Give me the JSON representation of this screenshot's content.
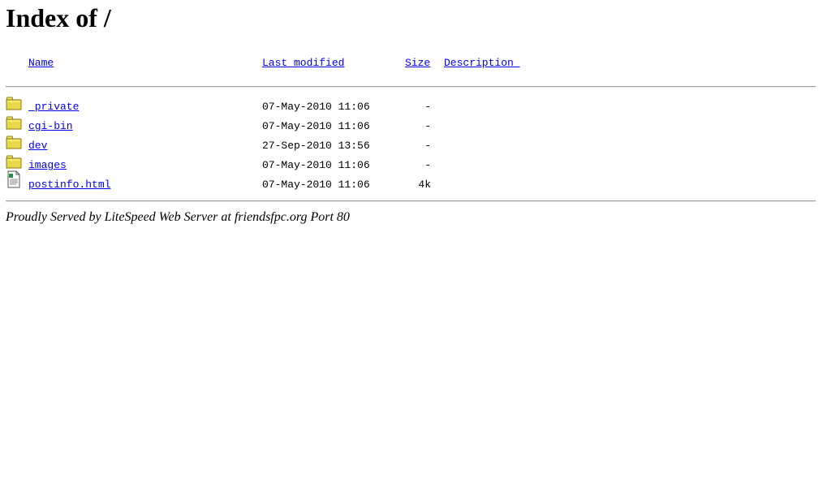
{
  "page": {
    "title": "Index of /"
  },
  "columns": {
    "name": "Name",
    "last_modified": "Last modified",
    "size": "Size",
    "description": "Description "
  },
  "entries": [
    {
      "icon": "folder-icon",
      "name": "_private",
      "last_modified": "07-May-2010 11:06",
      "size": "-"
    },
    {
      "icon": "folder-icon",
      "name": "cgi-bin",
      "last_modified": "07-May-2010 11:06",
      "size": "-"
    },
    {
      "icon": "folder-icon",
      "name": "dev",
      "last_modified": "27-Sep-2010 13:56",
      "size": "-"
    },
    {
      "icon": "folder-icon",
      "name": "images",
      "last_modified": "07-May-2010 11:06",
      "size": "-"
    },
    {
      "icon": "document-icon",
      "name": "postinfo.html",
      "last_modified": "07-May-2010 11:06",
      "size": "4k"
    }
  ],
  "footer": {
    "text": "Proudly Served by LiteSpeed Web Server at friendsfpc.org Port 80"
  },
  "colors": {
    "link": "#0000ee",
    "folder": "#e8d84a"
  }
}
